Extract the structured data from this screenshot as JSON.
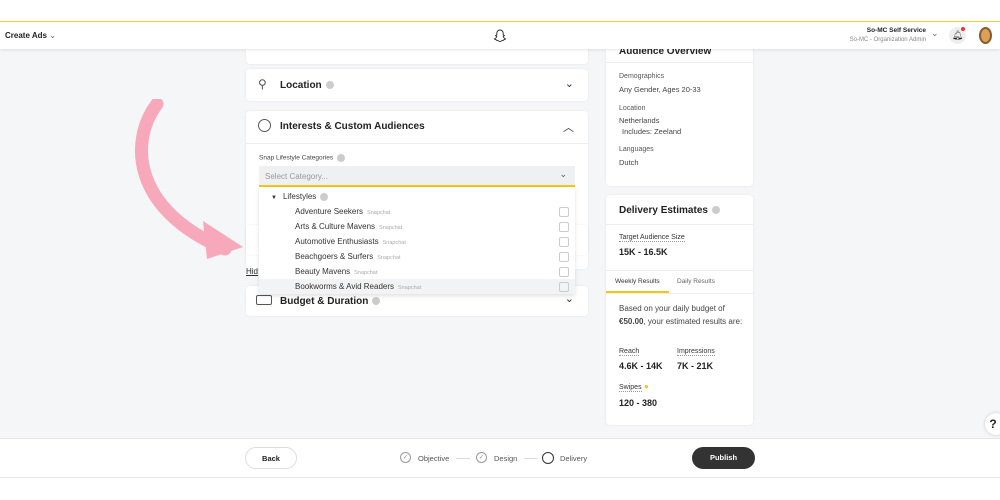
{
  "header": {
    "menu_label": "Create Ads",
    "org_name": "So-MC Self Service",
    "org_role": "So-MC - Organization Admin",
    "logo": "snapchat-ghost-icon",
    "accent": "#f5d33a"
  },
  "sections": {
    "location": "Location",
    "interests": "Interests & Custom Audiences",
    "budget": "Budget & Duration",
    "hide_link": "Hid"
  },
  "lifestyle": {
    "label": "Snap Lifestyle Categories",
    "placeholder": "Select Category...",
    "group": "Lifestyles",
    "items": [
      {
        "label": "Adventure Seekers",
        "source": "Snapchat"
      },
      {
        "label": "Arts & Culture Mavens",
        "source": "Snapchat"
      },
      {
        "label": "Automotive Enthusiasts",
        "source": "Snapchat"
      },
      {
        "label": "Beachgoers & Surfers",
        "source": "Snapchat"
      },
      {
        "label": "Beauty Mavens",
        "source": "Snapchat"
      },
      {
        "label": "Bookworms & Avid Readers",
        "source": "Snapchat"
      }
    ]
  },
  "audience": {
    "title": "Audience Overview",
    "demographics_label": "Demographics",
    "demographics": "Any Gender, Ages 20-33",
    "location_label": "Location",
    "location": "Netherlands",
    "location_includes": "Includes: Zeeland",
    "languages_label": "Languages",
    "languages": "Dutch"
  },
  "delivery": {
    "title": "Delivery Estimates",
    "target_label": "Target Audience Size",
    "target": "15K - 16.5K",
    "tabs": [
      "Weekly Results",
      "Daily Results"
    ],
    "text": "Based on your daily budget of",
    "budget": "€50.00",
    "text2": ", your estimated results are:",
    "reach_label": "Reach",
    "reach": "4.6K - 14K",
    "impressions_label": "Impressions",
    "impressions": "7K - 21K",
    "swipes_label": "Swipes",
    "swipes": "120 - 380"
  },
  "footer": {
    "back": "Back",
    "steps": [
      "Objective",
      "Design",
      "Delivery"
    ],
    "publish": "Publish"
  },
  "annotation": {
    "arrow_color": "#f7a8bb"
  }
}
